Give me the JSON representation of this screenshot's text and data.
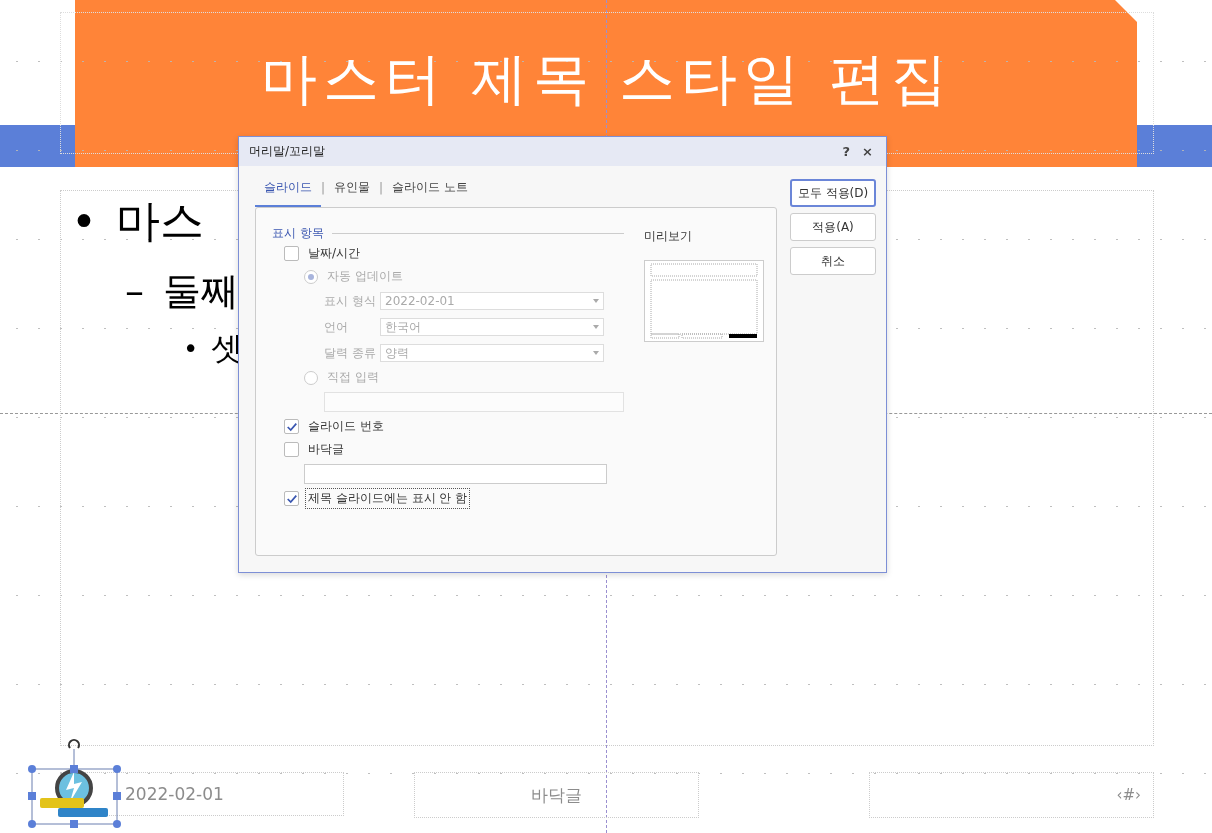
{
  "slide": {
    "title": "마스터 제목 스타일 편집",
    "body": [
      {
        "bullet": "•",
        "text": "마스",
        "children": [
          {
            "bullet": "–",
            "text": "둘째",
            "children": [
              {
                "bullet": "•",
                "text": "셋"
              }
            ]
          }
        ]
      }
    ],
    "footer": {
      "date": "2022-02-01",
      "text": "바닥글",
      "number": "‹#›"
    },
    "logo": {
      "kind": "picture",
      "selected": true
    }
  },
  "dialog": {
    "title": "머리말/꼬리말",
    "help": "?",
    "close": "×",
    "tabs": [
      {
        "label": "슬라이드",
        "selected": true
      },
      {
        "label": "유인물",
        "selected": false
      },
      {
        "label": "슬라이드 노트",
        "selected": false
      }
    ],
    "separators": [
      "|",
      "|"
    ],
    "section_title": "표시 항목",
    "preview_title": "미리보기",
    "options": [
      {
        "kind": "checkbox",
        "label": "날짜/시간",
        "checked": false,
        "disabled": false,
        "children": [
          {
            "kind": "radio",
            "label": "자동 업데이트",
            "selected": true,
            "disabled": true,
            "children": [
              {
                "kind": "dropdown",
                "label": "표시 형식",
                "value": "2022-02-01",
                "disabled": true
              },
              {
                "kind": "dropdown",
                "label": "언어",
                "value": "한국어",
                "disabled": true
              },
              {
                "kind": "dropdown",
                "label": "달력 종류",
                "value": "양력",
                "disabled": true
              }
            ]
          },
          {
            "kind": "radio",
            "label": "직접 입력",
            "selected": false,
            "disabled": true,
            "children": [
              {
                "kind": "field",
                "disabled": true
              }
            ]
          }
        ]
      },
      {
        "kind": "checkbox",
        "label": "슬라이드 번호",
        "checked": true,
        "disabled": false
      },
      {
        "kind": "checkbox",
        "label": "바닥글",
        "checked": false,
        "disabled": false,
        "children": [
          {
            "kind": "field",
            "disabled": false
          }
        ]
      },
      {
        "kind": "checkbox",
        "label": "제목 슬라이드에는 표시 안 함",
        "checked": true,
        "disabled": false,
        "focused": true
      }
    ],
    "buttons": [
      {
        "label": "모두 적용(D)",
        "default": true
      },
      {
        "label": "적용(A)",
        "default": false
      },
      {
        "label": "취소",
        "default": false
      }
    ]
  }
}
